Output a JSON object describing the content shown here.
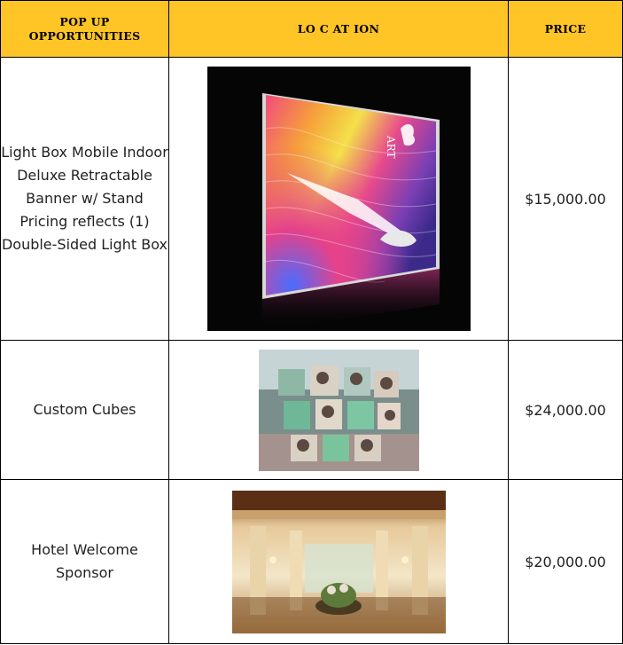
{
  "table": {
    "headers": {
      "opportunities": "POP UP\nOPPORTUNITIES",
      "location": "LO C AT ION",
      "price": "PRICE"
    },
    "rows": [
      {
        "name": "Light Box Mobile Indoor Deluxe Retractable Banner w/ Stand Pricing reflects (1) Double-Sided Light Box",
        "price": "$15,000.00",
        "image_art_lettering": "ART"
      },
      {
        "name": "Custom Cubes",
        "price": "$24,000.00"
      },
      {
        "name": "Hotel Welcome Sponsor",
        "price": "$20,000.00"
      }
    ]
  },
  "colors": {
    "header_background": "#ffc425",
    "border": "#000000",
    "text": "#222222"
  }
}
